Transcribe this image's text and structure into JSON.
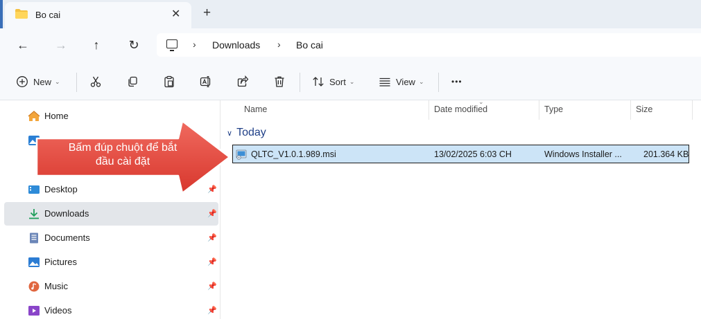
{
  "tab": {
    "title": "Bo cai",
    "close": "✕",
    "new": "+"
  },
  "nav": {
    "back": "←",
    "forward": "→",
    "up": "↑",
    "refresh": "↻"
  },
  "breadcrumb": {
    "items": [
      "Downloads",
      "Bo cai"
    ],
    "separator": "›"
  },
  "toolbar": {
    "new_label": "New",
    "sort_label": "Sort",
    "view_label": "View",
    "more": "•••",
    "dropdown": "⌄"
  },
  "sidebar": {
    "items": [
      {
        "label": "Home",
        "icon": "home-icon"
      },
      {
        "label": "",
        "icon": "gallery-icon"
      },
      {
        "label": "Desktop",
        "icon": "desktop-icon"
      },
      {
        "label": "Downloads",
        "icon": "download-icon"
      },
      {
        "label": "Documents",
        "icon": "documents-icon"
      },
      {
        "label": "Pictures",
        "icon": "pictures-icon"
      },
      {
        "label": "Music",
        "icon": "music-icon"
      },
      {
        "label": "Videos",
        "icon": "videos-icon"
      }
    ],
    "pin": "📌"
  },
  "columns": {
    "name": "Name",
    "date": "Date modified",
    "type": "Type",
    "size": "Size"
  },
  "group": {
    "label": "Today",
    "chevron": "∨"
  },
  "files": [
    {
      "name": "QLTC_V1.0.1.989.msi",
      "date": "13/02/2025 6:03 CH",
      "type": "Windows Installer ...",
      "size": "201.364 KB"
    }
  ],
  "annotation": {
    "line1": "Bấm đúp chuột để bắt",
    "line2": "đầu cài đặt"
  },
  "colors": {
    "accent": "#0067c0",
    "selection": "#cce4f7",
    "arrow": "#e8453c",
    "group": "#1f3f87"
  }
}
